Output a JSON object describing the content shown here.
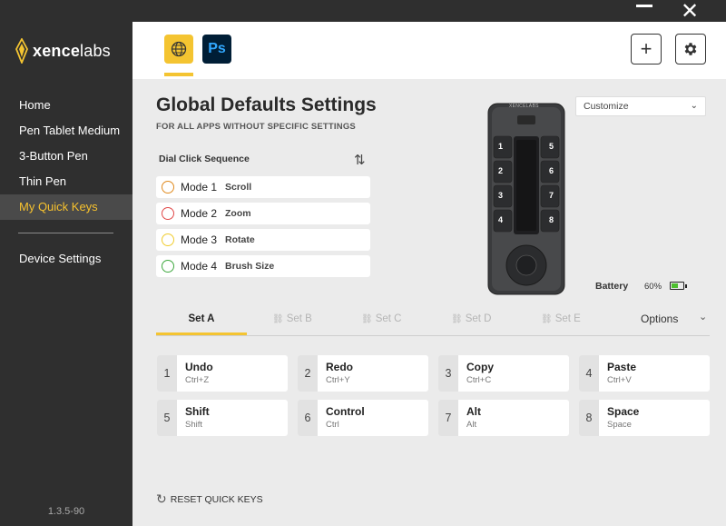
{
  "sidebar": {
    "logo": {
      "prefix": "xence",
      "suffix": "labs"
    },
    "items": [
      {
        "label": "Home"
      },
      {
        "label": "Pen Tablet Medium"
      },
      {
        "label": "3-Button Pen"
      },
      {
        "label": "Thin Pen"
      },
      {
        "label": "My Quick Keys"
      }
    ],
    "device_settings": "Device Settings",
    "version": "1.3.5-90"
  },
  "header": {
    "apps": [
      {
        "icon": "globe-icon"
      },
      {
        "label": "Ps",
        "icon": "photoshop-icon"
      }
    ],
    "add_label": "+"
  },
  "main": {
    "title": "Global Defaults Settings",
    "subtitle": "FOR ALL APPS WITHOUT SPECIFIC SETTINGS",
    "dial_label": "Dial Click Sequence",
    "modes": [
      {
        "name": "Mode 1",
        "action": "Scroll",
        "color": "#e08a1e"
      },
      {
        "name": "Mode 2",
        "action": "Zoom",
        "color": "#e04848"
      },
      {
        "name": "Mode 3",
        "action": "Rotate",
        "color": "#f0cc2e"
      },
      {
        "name": "Mode 4",
        "action": "Brush Size",
        "color": "#3fa83f"
      }
    ],
    "customize": "Customize",
    "battery_label": "Battery",
    "battery_percent": "60%",
    "battery_level": 0.6,
    "device_brand": "XENCELABS",
    "device_keys": [
      "1",
      "2",
      "3",
      "4",
      "5",
      "6",
      "7",
      "8"
    ],
    "sets": [
      {
        "label": "Set A"
      },
      {
        "label": "Set B"
      },
      {
        "label": "Set C"
      },
      {
        "label": "Set D"
      },
      {
        "label": "Set E"
      }
    ],
    "options_label": "Options",
    "keys": [
      {
        "num": "1",
        "name": "Undo",
        "shortcut": "Ctrl+Z"
      },
      {
        "num": "2",
        "name": "Redo",
        "shortcut": "Ctrl+Y"
      },
      {
        "num": "3",
        "name": "Copy",
        "shortcut": "Ctrl+C"
      },
      {
        "num": "4",
        "name": "Paste",
        "shortcut": "Ctrl+V"
      },
      {
        "num": "5",
        "name": "Shift",
        "shortcut": "Shift"
      },
      {
        "num": "6",
        "name": "Control",
        "shortcut": "Ctrl"
      },
      {
        "num": "7",
        "name": "Alt",
        "shortcut": "Alt"
      },
      {
        "num": "8",
        "name": "Space",
        "shortcut": "Space"
      }
    ],
    "reset_label": "RESET QUICK KEYS"
  },
  "colors": {
    "accent": "#f4c431",
    "sidebar_bg": "#2f2f2f",
    "active_nav_text": "#f6c12e"
  }
}
